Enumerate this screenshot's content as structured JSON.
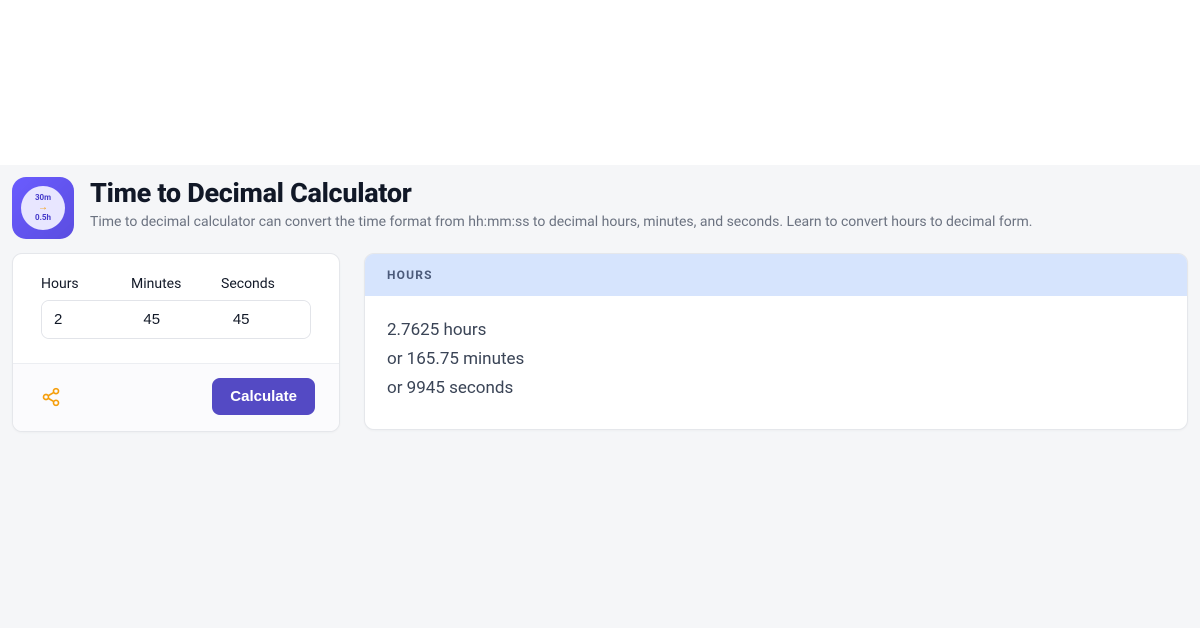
{
  "header": {
    "icon": {
      "top": "30m",
      "bottom": "0.5h"
    },
    "title": "Time to Decimal Calculator",
    "subtitle": "Time to decimal calculator can convert the time format from hh:mm:ss to decimal hours, minutes, and seconds. Learn to convert hours to decimal form."
  },
  "form": {
    "labels": {
      "hours": "Hours",
      "minutes": "Minutes",
      "seconds": "Seconds"
    },
    "values": {
      "hours": "2",
      "minutes": "45",
      "seconds": "45"
    },
    "calculate_label": "Calculate"
  },
  "result": {
    "section_label": "HOURS",
    "line1": "2.7625 hours",
    "line2": "or 165.75 minutes",
    "line3": "or 9945 seconds"
  }
}
